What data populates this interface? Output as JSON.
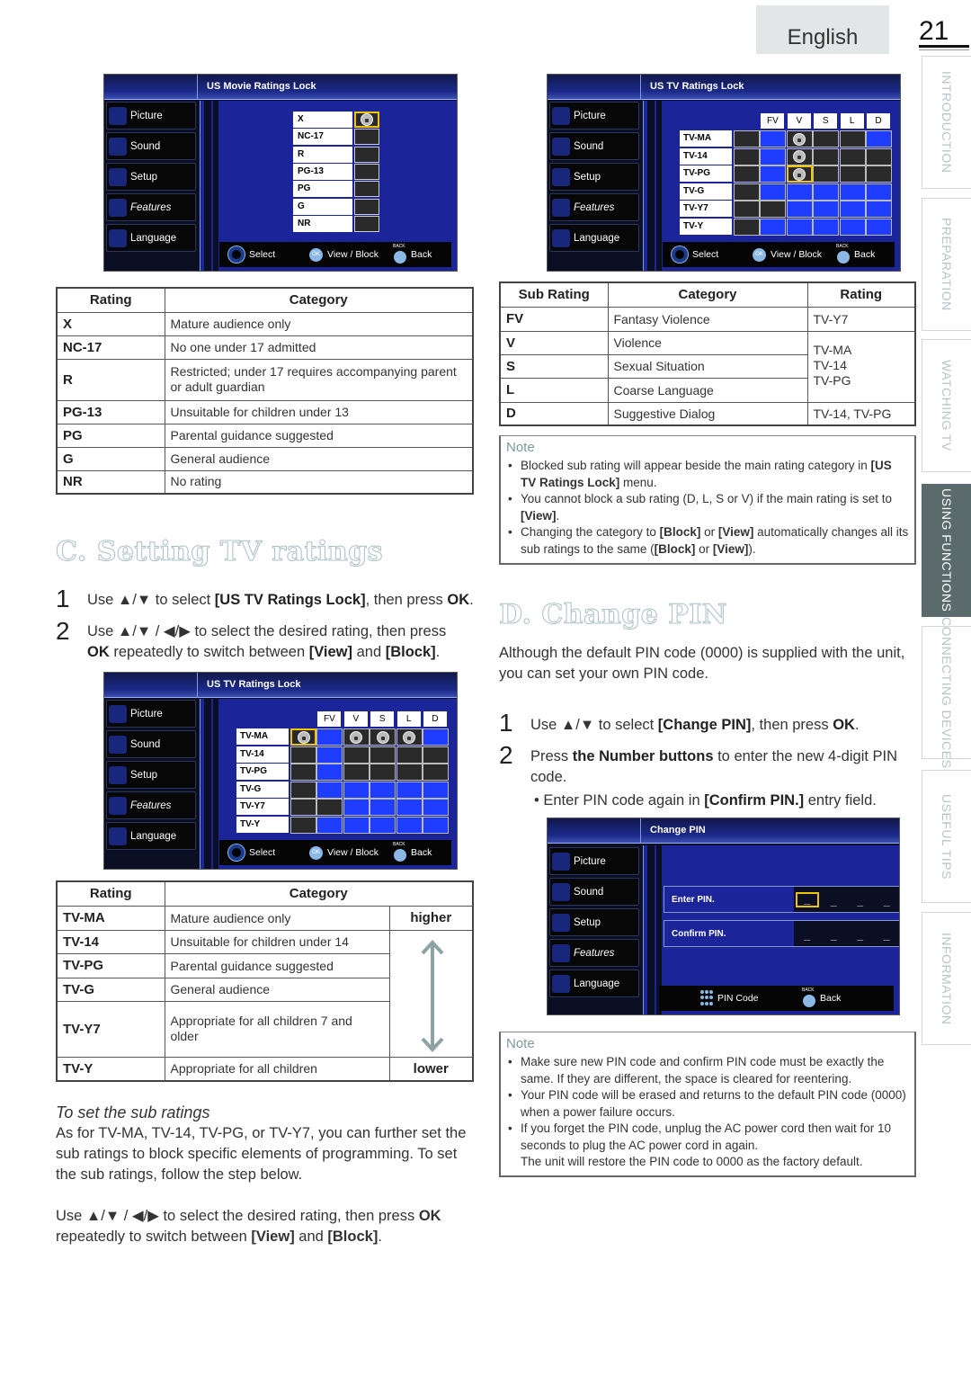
{
  "header": {
    "language_tab": "English",
    "page_number": "21"
  },
  "side_tabs": [
    {
      "label": "INTRODUCTION",
      "active": false
    },
    {
      "label": "PREPARATION",
      "active": false
    },
    {
      "label": "WATCHING TV",
      "active": false
    },
    {
      "label": "USING FUNCTIONS",
      "active": true
    },
    {
      "label": "CONNECTING DEVICES",
      "active": false
    },
    {
      "label": "USEFUL TIPS",
      "active": false
    },
    {
      "label": "INFORMATION",
      "active": false
    }
  ],
  "tv_menu": {
    "items": [
      "Picture",
      "Sound",
      "Setup",
      "Features",
      "Language"
    ]
  },
  "tv_footer": {
    "select": "Select",
    "view_block": "View / Block",
    "back": "Back",
    "ok_label": "OK",
    "pin_code": "PIN Code"
  },
  "screen_movie": {
    "title": "US Movie Ratings Lock",
    "ratings": [
      {
        "label": "X",
        "locked": true,
        "selected": true
      },
      {
        "label": "NC-17",
        "locked": false,
        "selected": false
      },
      {
        "label": "R",
        "locked": false,
        "selected": false
      },
      {
        "label": "PG-13",
        "locked": false,
        "selected": false
      },
      {
        "label": "PG",
        "locked": false,
        "selected": false
      },
      {
        "label": "G",
        "locked": false,
        "selected": false
      },
      {
        "label": "NR",
        "locked": false,
        "selected": false
      }
    ]
  },
  "screen_tv_sub": {
    "title": "US TV Ratings Lock",
    "columns": [
      "FV",
      "V",
      "S",
      "L",
      "D"
    ],
    "rows": [
      {
        "label": "TV-MA",
        "cells": [
          "blk",
          "blu",
          "lock",
          "blk",
          "blk",
          "blu"
        ]
      },
      {
        "label": "TV-14",
        "cells": [
          "blk",
          "blu",
          "lock",
          "blk",
          "blk",
          "blk"
        ]
      },
      {
        "label": "TV-PG",
        "cells": [
          "blk",
          "blu",
          "lock-sel",
          "blk",
          "blk",
          "blk"
        ]
      },
      {
        "label": "TV-G",
        "cells": [
          "blk",
          "blu",
          "blu",
          "blu",
          "blu",
          "blu"
        ]
      },
      {
        "label": "TV-Y7",
        "cells": [
          "blk",
          "blk",
          "blu",
          "blu",
          "blu",
          "blu"
        ]
      },
      {
        "label": "TV-Y",
        "cells": [
          "blk",
          "blu",
          "blu",
          "blu",
          "blu",
          "blu"
        ]
      }
    ]
  },
  "screen_tv_main": {
    "title": "US TV Ratings Lock",
    "columns": [
      "FV",
      "V",
      "S",
      "L",
      "D"
    ],
    "rows": [
      {
        "label": "TV-MA",
        "cells": [
          "lock-sel",
          "blu",
          "lock",
          "lock",
          "lock",
          "blu"
        ]
      },
      {
        "label": "TV-14",
        "cells": [
          "blk",
          "blu",
          "blk",
          "blk",
          "blk",
          "blk"
        ]
      },
      {
        "label": "TV-PG",
        "cells": [
          "blk",
          "blu",
          "blk",
          "blk",
          "blk",
          "blk"
        ]
      },
      {
        "label": "TV-G",
        "cells": [
          "blk",
          "blu",
          "blu",
          "blu",
          "blu",
          "blu"
        ]
      },
      {
        "label": "TV-Y7",
        "cells": [
          "blk",
          "blk",
          "blu",
          "blu",
          "blu",
          "blu"
        ]
      },
      {
        "label": "TV-Y",
        "cells": [
          "blk",
          "blu",
          "blu",
          "blu",
          "blu",
          "blu"
        ]
      }
    ]
  },
  "screen_pin": {
    "title": "Change PIN",
    "enter_label": "Enter PIN.",
    "confirm_label": "Confirm PIN.",
    "digit_placeholder": "_"
  },
  "movie_table": {
    "headers": [
      "Rating",
      "Category"
    ],
    "rows": [
      [
        "X",
        "Mature audience only"
      ],
      [
        "NC-17",
        "No one under 17 admitted"
      ],
      [
        "R",
        "Restricted; under 17 requires accompanying parent or adult guardian"
      ],
      [
        "PG-13",
        "Unsuitable for children under 13"
      ],
      [
        "PG",
        "Parental guidance suggested"
      ],
      [
        "G",
        "General audience"
      ],
      [
        "NR",
        "No rating"
      ]
    ]
  },
  "section_c": {
    "title": "C. Setting TV ratings",
    "step1_num": "1",
    "step1_pre": "Use ▲/▼ to select ",
    "step1_bold": "[US TV Ratings Lock]",
    "step1_post": ", then press ",
    "step1_ok": "OK",
    "step1_end": ".",
    "step2_num": "2",
    "step2_pre": "Use ▲/▼ / ◀/▶ to select the desired rating, then press ",
    "step2_ok": "OK",
    "step2_mid": " repeatedly to switch between ",
    "step2_view": "[View]",
    "step2_and": " and ",
    "step2_block": "[Block]",
    "step2_end": "."
  },
  "tv_table": {
    "headers": [
      "Rating",
      "Category"
    ],
    "higher": "higher",
    "lower": "lower",
    "rows": [
      [
        "TV-MA",
        "Mature audience only"
      ],
      [
        "TV-14",
        "Unsuitable for children under 14"
      ],
      [
        "TV-PG",
        "Parental guidance suggested"
      ],
      [
        "TV-G",
        "General audience"
      ],
      [
        "TV-Y7",
        "Appropriate for all children 7 and older"
      ],
      [
        "TV-Y",
        "Appropriate for all children"
      ]
    ]
  },
  "sub_ratings_section": {
    "heading": "To set the sub ratings",
    "para": "As for TV-MA, TV-14, TV-PG, or TV-Y7, you can further set the sub ratings to block specific elements of programming. To set the sub ratings, follow the step below.",
    "use_pre": "Use ▲/▼ / ◀/▶  to select the desired rating, then press ",
    "use_ok": "OK",
    "use_mid": " repeatedly to switch between ",
    "use_view": "[View]",
    "use_and": " and ",
    "use_block": "[Block]",
    "use_end": "."
  },
  "sub_table": {
    "headers": [
      "Sub Rating",
      "Category",
      "Rating"
    ],
    "rows": [
      {
        "sub": "FV",
        "category": "Fantasy Violence"
      },
      {
        "sub": "V",
        "category": "Violence"
      },
      {
        "sub": "S",
        "category": "Sexual Situation"
      },
      {
        "sub": "L",
        "category": "Coarse Language"
      },
      {
        "sub": "D",
        "category": "Suggestive Dialog"
      }
    ],
    "rating_fv": "TV-Y7",
    "rating_vsl": [
      "TV-MA",
      "TV-14",
      "TV-PG"
    ],
    "rating_d": "TV-14, TV-PG"
  },
  "note1": {
    "title": "Note",
    "item1_pre": "Blocked sub rating will appear beside the main rating category in ",
    "item1_bold": "[US TV Ratings Lock]",
    "item1_post": " menu.",
    "item2_pre": "You cannot block a sub rating (D, L, S or V) if the main rating is set to ",
    "item2_bold": "[View]",
    "item2_post": ".",
    "item3_pre": "Changing the category to ",
    "item3_b1": "[Block]",
    "item3_or": " or ",
    "item3_b2": "[View]",
    "item3_mid": " automatically changes all its sub ratings to the same (",
    "item3_b3": "[Block]",
    "item3_or2": " or ",
    "item3_b4": "[View]",
    "item3_end": ")."
  },
  "section_d": {
    "title": "D. Change PIN",
    "intro": "Although the default PIN code (0000) is supplied with the unit, you can set your own PIN code.",
    "step1_num": "1",
    "step1_pre": "Use ▲/▼ to select ",
    "step1_bold": "[Change PIN]",
    "step1_post": ", then press ",
    "step1_ok": "OK",
    "step1_end": ".",
    "step2_num": "2",
    "step2_pre": "Press ",
    "step2_bold": "the Number buttons",
    "step2_post": " to enter the new 4-digit PIN code.",
    "bullet_pre": "Enter PIN code again in ",
    "bullet_bold": "[Confirm PIN.]",
    "bullet_post": " entry field."
  },
  "note2": {
    "title": "Note",
    "items": [
      "Make sure new PIN code and confirm PIN code must be exactly the same. If they are different, the space is cleared for reentering.",
      "Your PIN code will be erased and returns to the default PIN code (0000) when a power failure occurs.",
      "If you forget the PIN code, unplug the AC power cord then wait for 10 seconds to plug the AC power cord in again."
    ],
    "trailer": "The unit will restore the PIN code to 0000 as the factory default."
  }
}
